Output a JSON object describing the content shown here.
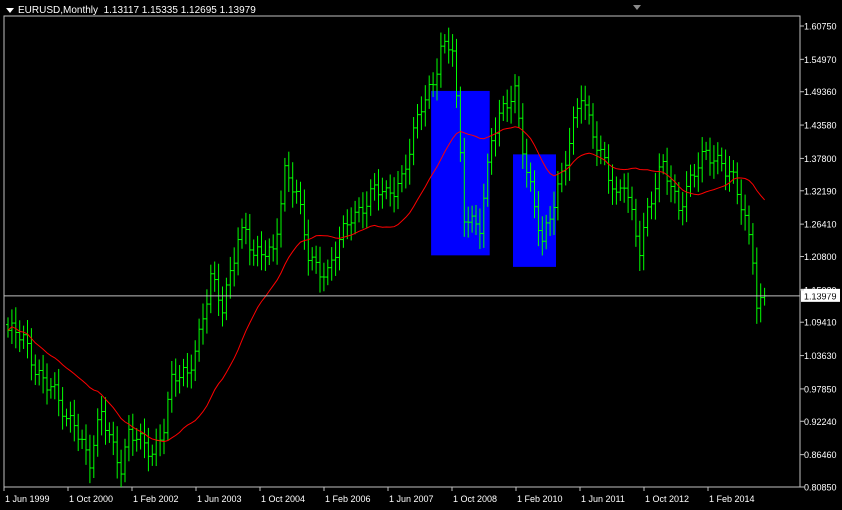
{
  "header": {
    "symbol_timeframe": "EURUSD,Monthly",
    "ohlc": "1.13117 1.15335 1.12695 1.13979"
  },
  "colors": {
    "background": "#000000",
    "frame": "#c0c0c0",
    "bars": "#00ff00",
    "ma": "#ff0000",
    "highlight": "#0000ff",
    "price_line": "#c0c0c0",
    "text": "#ffffff"
  },
  "chart_data": {
    "type": "ohlc-bar",
    "x_tick_labels": [
      "1 Jun 1999",
      "1 Oct 2000",
      "1 Feb 2002",
      "1 Jun 2003",
      "1 Oct 2004",
      "1 Feb 2006",
      "1 Jun 2007",
      "1 Oct 2008",
      "1 Feb 2010",
      "1 Jun 2011",
      "1 Oct 2012",
      "1 Feb 2014"
    ],
    "y_tick_labels": [
      "1.60750",
      "1.54970",
      "1.49360",
      "1.43580",
      "1.37800",
      "1.32190",
      "1.26410",
      "1.20800",
      "1.15020",
      "1.09410",
      "1.03630",
      "0.97850",
      "0.92240",
      "0.86460",
      "0.80850"
    ],
    "ylim": [
      0.8085,
      1.6075
    ],
    "current_price": 1.13979,
    "current_price_label": "1.13979",
    "start_month": "1999-01",
    "end_month": "2015-03",
    "close_anchors": [
      [
        "1999-01",
        1.08
      ],
      [
        "1999-05",
        1.06
      ],
      [
        "1999-08",
        1.02
      ],
      [
        "1999-12",
        0.98
      ],
      [
        "2000-04",
        0.92
      ],
      [
        "2000-06",
        0.93
      ],
      [
        "2000-10",
        0.85
      ],
      [
        "2001-01",
        0.93
      ],
      [
        "2001-06",
        0.85
      ],
      [
        "2001-08",
        0.9
      ],
      [
        "2001-11",
        0.88
      ],
      [
        "2002-02",
        0.87
      ],
      [
        "2002-05",
        0.92
      ],
      [
        "2002-07",
        0.99
      ],
      [
        "2002-11",
        1.0
      ],
      [
        "2003-02",
        1.08
      ],
      [
        "2003-05",
        1.17
      ],
      [
        "2003-06",
        1.15
      ],
      [
        "2003-08",
        1.11
      ],
      [
        "2003-12",
        1.25
      ],
      [
        "2004-02",
        1.26
      ],
      [
        "2004-04",
        1.2
      ],
      [
        "2004-09",
        1.22
      ],
      [
        "2004-12",
        1.36
      ],
      [
        "2005-03",
        1.31
      ],
      [
        "2005-06",
        1.21
      ],
      [
        "2005-11",
        1.18
      ],
      [
        "2006-01",
        1.21
      ],
      [
        "2006-05",
        1.28
      ],
      [
        "2006-11",
        1.32
      ],
      [
        "2007-02",
        1.31
      ],
      [
        "2007-06",
        1.35
      ],
      [
        "2007-11",
        1.46
      ],
      [
        "2008-02",
        1.51
      ],
      [
        "2008-04",
        1.58
      ],
      [
        "2008-07",
        1.57
      ],
      [
        "2008-10",
        1.27
      ],
      [
        "2008-11",
        1.27
      ],
      [
        "2009-02",
        1.27
      ],
      [
        "2009-05",
        1.41
      ],
      [
        "2009-11",
        1.5
      ],
      [
        "2010-02",
        1.36
      ],
      [
        "2010-06",
        1.22
      ],
      [
        "2010-08",
        1.28
      ],
      [
        "2010-11",
        1.36
      ],
      [
        "2011-04",
        1.48
      ],
      [
        "2011-06",
        1.44
      ],
      [
        "2011-10",
        1.38
      ],
      [
        "2012-01",
        1.3
      ],
      [
        "2012-03",
        1.33
      ],
      [
        "2012-07",
        1.23
      ],
      [
        "2012-09",
        1.29
      ],
      [
        "2013-01",
        1.36
      ],
      [
        "2013-05",
        1.3
      ],
      [
        "2013-07",
        1.33
      ],
      [
        "2013-12",
        1.38
      ],
      [
        "2014-04",
        1.38
      ],
      [
        "2014-07",
        1.34
      ],
      [
        "2014-12",
        1.21
      ],
      [
        "2015-01",
        1.13
      ],
      [
        "2015-03",
        1.14
      ]
    ],
    "moving_average": {
      "period": 24,
      "method": "simple"
    },
    "highlight_boxes": [
      {
        "from": "2008-02",
        "to": "2009-04",
        "top": 1.495,
        "bottom": 1.21
      },
      {
        "from": "2009-11",
        "to": "2010-09",
        "top": 1.385,
        "bottom": 1.19
      }
    ]
  }
}
